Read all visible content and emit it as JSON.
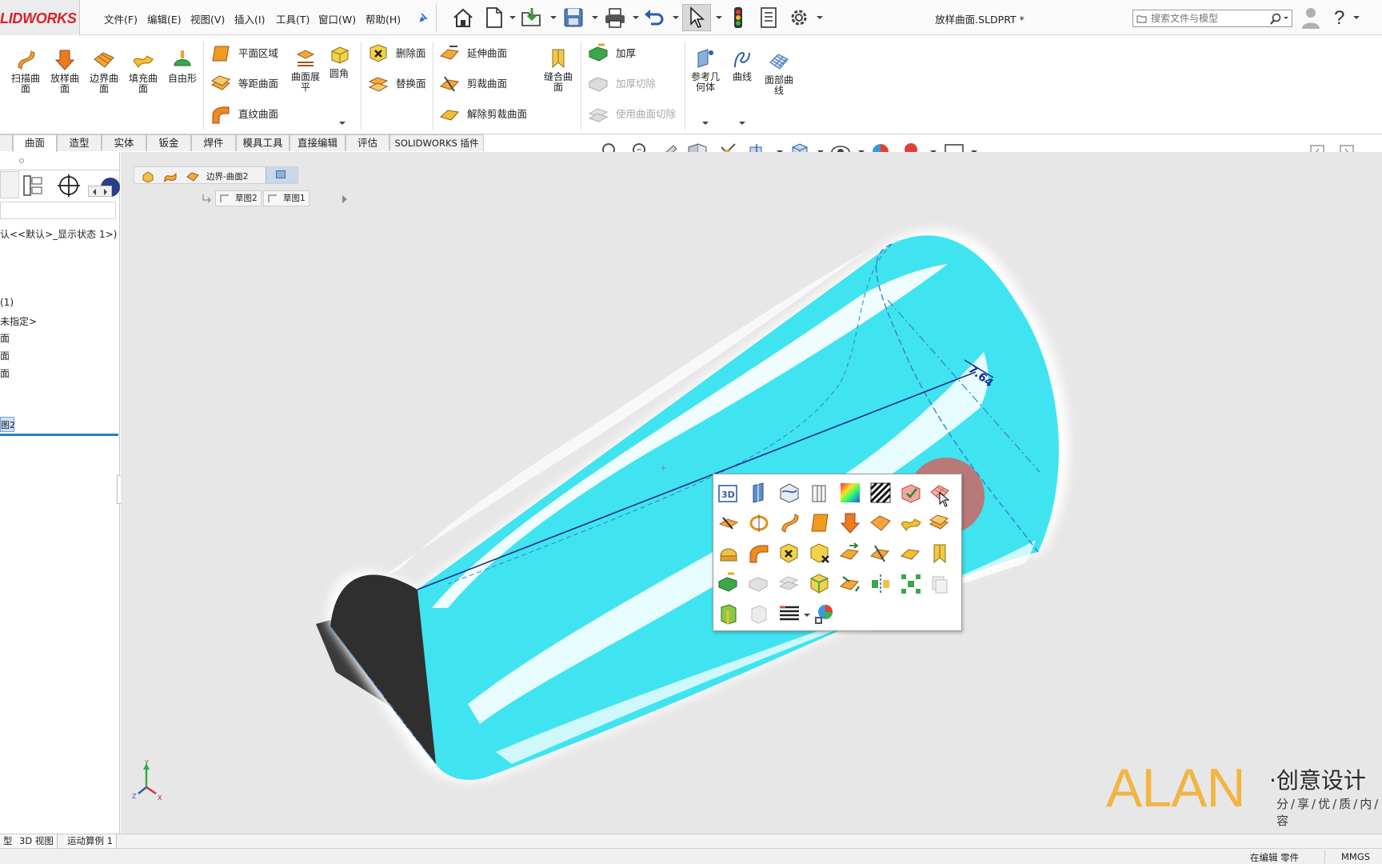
{
  "app": {
    "brand": "SOLIDWORKS",
    "logo_text": "LIDWORKS",
    "document_title": "放样曲面.SLDPRT *"
  },
  "menu": [
    "文件(F)",
    "编辑(E)",
    "视图(V)",
    "插入(I)",
    "工具(T)",
    "窗口(W)",
    "帮助(H)"
  ],
  "search": {
    "placeholder": "搜索文件与模型"
  },
  "ribbon": {
    "big_tools": [
      {
        "label": "扫描曲\n面",
        "icon": "swept-surface-icon"
      },
      {
        "label": "放样曲\n面",
        "icon": "lofted-surface-icon"
      },
      {
        "label": "边界曲\n面",
        "icon": "boundary-surface-icon"
      },
      {
        "label": "填充曲\n面",
        "icon": "filled-surface-icon"
      },
      {
        "label": "自由形",
        "icon": "freeform-icon"
      }
    ],
    "group2": [
      {
        "label": "平面区域",
        "icon": "planar-surface-icon"
      },
      {
        "label": "等距曲面",
        "icon": "offset-surface-icon"
      },
      {
        "label": "直纹曲面",
        "icon": "ruled-surface-icon"
      }
    ],
    "flatten": {
      "label": "曲面展\n平",
      "icon": "surface-flatten-icon"
    },
    "fillet": {
      "label": "圆角",
      "icon": "fillet-icon"
    },
    "group3": [
      {
        "label": "删除面",
        "icon": "delete-face-icon"
      },
      {
        "label": "替换面",
        "icon": "replace-face-icon"
      }
    ],
    "group4": [
      {
        "label": "延伸曲面",
        "icon": "extend-surface-icon"
      },
      {
        "label": "剪裁曲面",
        "icon": "trim-surface-icon"
      },
      {
        "label": "解除剪裁曲面",
        "icon": "untrim-surface-icon"
      }
    ],
    "knit": {
      "label": "缝合曲\n面",
      "icon": "knit-surface-icon"
    },
    "group5": [
      {
        "label": "加厚",
        "enabled": true
      },
      {
        "label": "加厚切除",
        "enabled": false
      },
      {
        "label": "使用曲面切除",
        "enabled": false
      }
    ],
    "ref_geometry": {
      "label": "参考几\n何体"
    },
    "curves": {
      "label": "曲线"
    },
    "face_curves": {
      "label": "面部曲\n线"
    }
  },
  "tabs": [
    {
      "label": "曲面",
      "active": true
    },
    {
      "label": "造型",
      "active": false
    },
    {
      "label": "实体",
      "active": false
    },
    {
      "label": "钣金",
      "active": false
    },
    {
      "label": "焊件",
      "active": false
    },
    {
      "label": "模具工具",
      "active": false
    },
    {
      "label": "直接编辑",
      "active": false
    },
    {
      "label": "评估",
      "active": false
    },
    {
      "label": "SOLIDWORKS 插件",
      "active": false
    }
  ],
  "feature_tree": {
    "config_line": "认<<默认>_显示状态 1>)",
    "items": [
      "(1)",
      "未指定>",
      "面",
      "面",
      "面"
    ],
    "selected": "图2"
  },
  "breadcrumb": {
    "feature": "边界-曲面2",
    "sketches": [
      "草图2",
      "草图1"
    ]
  },
  "viewport": {
    "dimension_label": "7.64",
    "triad": {
      "x": "X",
      "y": "Y",
      "z": "Z"
    }
  },
  "watermark": {
    "brand": "ALAN",
    "title": "·创意设计",
    "subtitle": "分/享/优/质/内/容"
  },
  "bottom_tabs": [
    "型",
    "3D 视图",
    "运动算例 1"
  ],
  "status": {
    "mode": "在编辑 零件",
    "units": "MMGS"
  },
  "colors": {
    "surface": "#35e0ee",
    "accent_red": "#d8202a",
    "watermark_orange": "#f2b544"
  }
}
